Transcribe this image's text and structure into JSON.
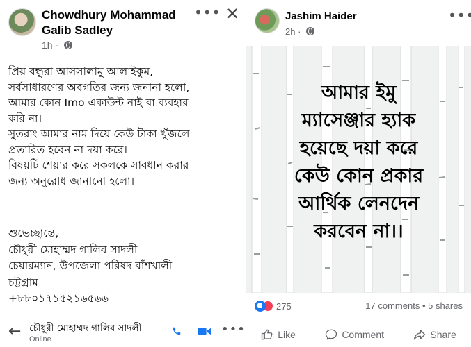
{
  "left_post": {
    "author": "Chowdhury Mohammad Galib Sadley",
    "time": "1h",
    "body_lines": [
      "প্রিয় বন্ধুরা আসসালামু আলাইকুম,",
      "সর্বসাধারণের অবগতির জন্য জনানা হলো,",
      "আমার কোন Imo একাউন্ট নাই বা ব্যবহার",
      "করি না।",
      "সুতরাং আমার নাম দিয়ে কেউ টাকা খুঁজলে",
      "প্রতারিত হবেন না দয়া করে।",
      "বিষয়টি শেয়ার করে সকলকে সাবধান করার",
      "জন্য অনুরোধ জানানো হলো।"
    ],
    "signature_lines": [
      "শুভেচ্ছান্তে,",
      "চৌধুরী মোহাম্মদ গালিব সাদলী",
      "চেয়ারম্যান, উপজেলা পরিষদ বাঁশখালী",
      "চট্টগ্রাম",
      "+৮৮০১৭১৫২১৬৫৬৬"
    ],
    "menu_icon": "more-horizontal-icon",
    "close_icon": "close-icon"
  },
  "chat_bar": {
    "name": "চৌধুরী মোহাম্মদ গালিব সাদলী",
    "status": "Online",
    "back_icon": "arrow-left-icon",
    "call_icon": "phone-icon",
    "video_icon": "video-camera-icon"
  },
  "right_post": {
    "author": "Jashim Haider",
    "time": "2h",
    "image_text_lines": [
      "আমার ইমু",
      "ম্যাসেঞ্জার হ্যাক",
      "হয়েছে দয়া করে",
      "কেউ  কোন প্রকার",
      "আর্থিক লেনদেন",
      "করবেন না।।"
    ],
    "reaction_count": "275",
    "comments": "17 comments",
    "shares": "5 shares",
    "separator": " • ",
    "actions": {
      "like": "Like",
      "comment": "Comment",
      "share": "Share"
    }
  },
  "colors": {
    "facebook_blue": "#1877f2",
    "secondary_text": "#65676b",
    "love_red": "#f33e58",
    "image_background": "#f0f1f1"
  }
}
